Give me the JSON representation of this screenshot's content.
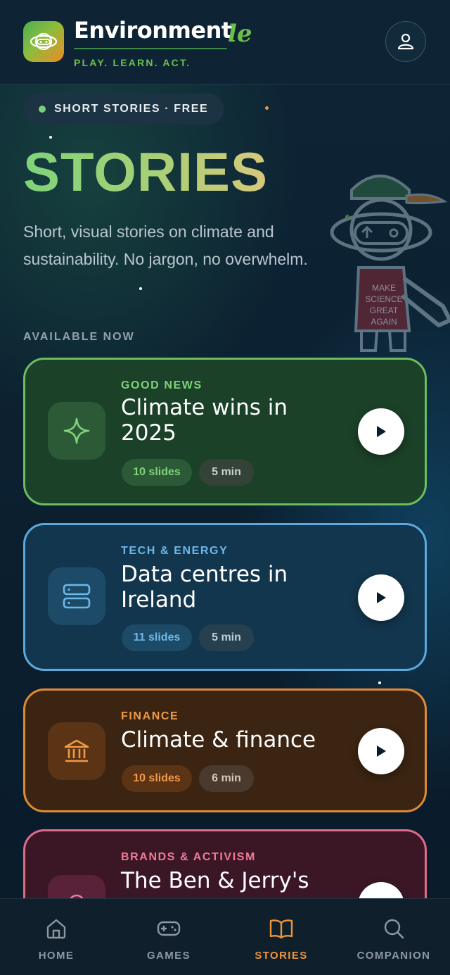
{
  "header": {
    "brand": "Environment",
    "brand_suffix": "le",
    "tagline": "PLAY. LEARN. ACT.",
    "profile_icon": "user-icon"
  },
  "hero": {
    "pill": "SHORT STORIES · FREE",
    "title": "STORIES",
    "subtitle": "Short, visual stories on climate and sustainability. No jargon, no overwhelm.",
    "section_label": "AVAILABLE NOW",
    "mascot_shirt": [
      "MAKE",
      "SCIENCE",
      "GREAT",
      "AGAIN"
    ]
  },
  "stories": [
    {
      "category": "GOOD NEWS",
      "title": "Climate wins in 2025",
      "slides": "10 slides",
      "duration": "5 min",
      "icon": "sparkle-icon",
      "accent": "#6dbd5e"
    },
    {
      "category": "TECH & ENERGY",
      "title": "Data centres in Ireland",
      "slides": "11 slides",
      "duration": "5 min",
      "icon": "server-icon",
      "accent": "#5ba9de"
    },
    {
      "category": "FINANCE",
      "title": "Climate & finance",
      "slides": "10 slides",
      "duration": "6 min",
      "icon": "bank-icon",
      "accent": "#e08a36"
    },
    {
      "category": "BRANDS & ACTIVISM",
      "title": "The Ben & Jerry's",
      "icon": "bell-icon",
      "accent": "#e06a8a"
    }
  ],
  "nav": [
    {
      "label": "HOME",
      "icon": "home-icon",
      "active": false
    },
    {
      "label": "GAMES",
      "icon": "gamepad-icon",
      "active": false
    },
    {
      "label": "STORIES",
      "icon": "book-icon",
      "active": true
    },
    {
      "label": "COMPANION",
      "icon": "search-icon",
      "active": false
    }
  ],
  "colors": {
    "background": "#0c2233",
    "brand_green": "#6cc04a",
    "active_nav": "#f0953a"
  }
}
